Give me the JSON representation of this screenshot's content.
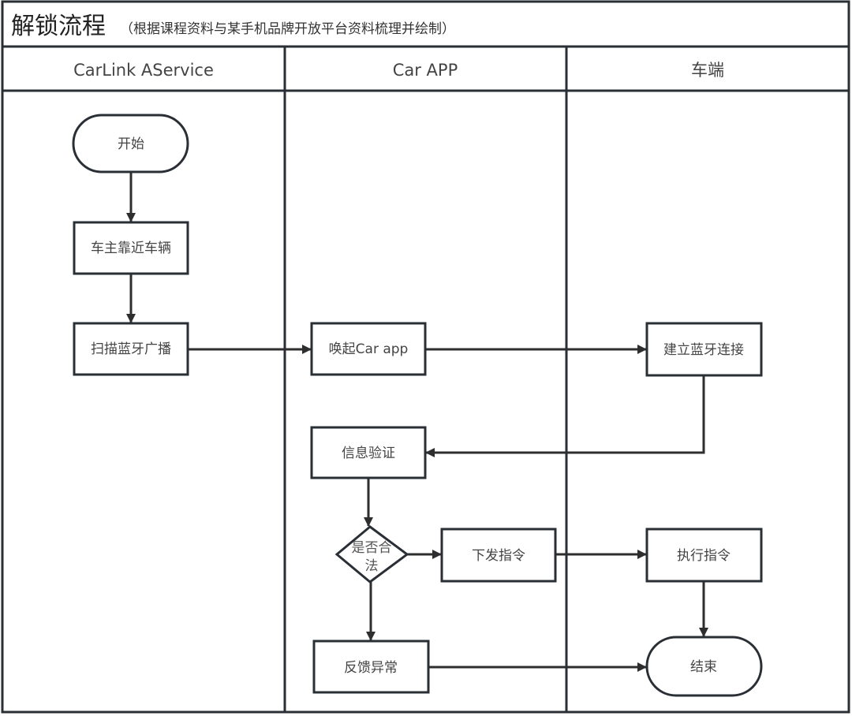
{
  "title": {
    "main": "解锁流程",
    "subtitle": "（根据课程资料与某手机品牌开放平台资料梳理并绘制）"
  },
  "lanes": [
    {
      "id": "carlink",
      "label": "CarLink AService"
    },
    {
      "id": "carapp",
      "label": "Car APP"
    },
    {
      "id": "vehicle",
      "label": "车端"
    }
  ],
  "nodes": {
    "start": {
      "label": "开始",
      "type": "terminator",
      "lane": "carlink"
    },
    "approach": {
      "label": "车主靠近车辆",
      "type": "process",
      "lane": "carlink"
    },
    "scan": {
      "label": "扫描蓝牙广播",
      "type": "process",
      "lane": "carlink"
    },
    "wake": {
      "label": "唤起Car app",
      "type": "process",
      "lane": "carapp"
    },
    "connect": {
      "label": "建立蓝牙连接",
      "type": "process",
      "lane": "vehicle"
    },
    "verify": {
      "label": "信息验证",
      "type": "process",
      "lane": "carapp"
    },
    "legal": {
      "label_line1": "是否合",
      "label_line2": "法",
      "type": "decision",
      "lane": "carapp"
    },
    "dispatch": {
      "label": "下发指令",
      "type": "process",
      "lane": "carapp"
    },
    "execute": {
      "label": "执行指令",
      "type": "process",
      "lane": "vehicle"
    },
    "feedback": {
      "label": "反馈异常",
      "type": "process",
      "lane": "carapp"
    },
    "end": {
      "label": "结束",
      "type": "terminator",
      "lane": "vehicle"
    }
  },
  "edges": [
    {
      "from": "start",
      "to": "approach"
    },
    {
      "from": "approach",
      "to": "scan"
    },
    {
      "from": "scan",
      "to": "wake"
    },
    {
      "from": "wake",
      "to": "connect"
    },
    {
      "from": "connect",
      "to": "verify"
    },
    {
      "from": "verify",
      "to": "legal"
    },
    {
      "from": "legal",
      "to": "dispatch"
    },
    {
      "from": "legal",
      "to": "feedback"
    },
    {
      "from": "dispatch",
      "to": "execute"
    },
    {
      "from": "execute",
      "to": "end"
    },
    {
      "from": "feedback",
      "to": "end"
    }
  ]
}
